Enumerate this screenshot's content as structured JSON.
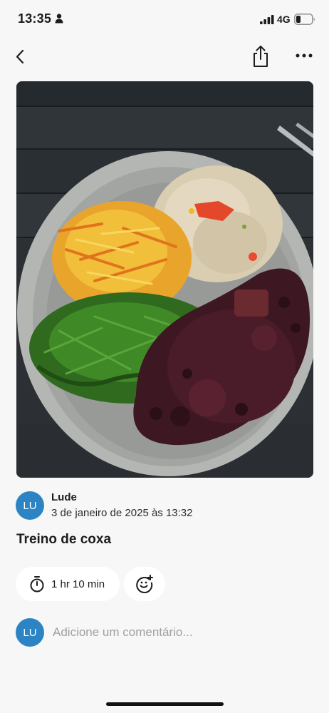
{
  "status_bar": {
    "time": "13:35",
    "network": "4G",
    "icons": [
      "person-icon",
      "signal-bars-icon",
      "battery-icon"
    ]
  },
  "nav": {
    "icons": [
      "chevron-left-icon",
      "share-icon",
      "more-horizontal-icon"
    ]
  },
  "post": {
    "photo_icon": "meal-photo",
    "author": {
      "initials": "LU",
      "name": "Lude",
      "avatar_color": "#2d84c4"
    },
    "date": "3 de janeiro de 2025 às 13:32",
    "title": "Treino de coxa",
    "duration": {
      "icon": "stopwatch-icon",
      "label": "1 hr 10 min"
    },
    "reaction_icon": "add-reaction-icon"
  },
  "comment": {
    "avatar_initials": "LU",
    "placeholder": "Adicione um comentário..."
  },
  "colors": {
    "background": "#f7f7f7",
    "chip_background": "#ffffff",
    "accent": "#2d84c4",
    "placeholder": "#a0a0a5"
  }
}
